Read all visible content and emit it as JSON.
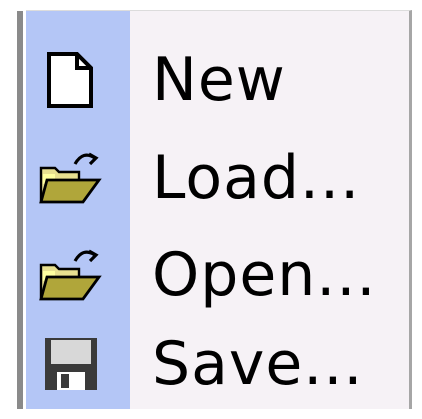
{
  "menu": {
    "items": [
      {
        "label": "New",
        "icon": "new-document-icon"
      },
      {
        "label": "Load...",
        "icon": "open-folder-icon"
      },
      {
        "label": "Open...",
        "icon": "open-folder-icon"
      },
      {
        "label": "Save...",
        "icon": "floppy-disk-icon"
      }
    ]
  },
  "colors": {
    "gutter": "#b4c6f6",
    "menu_bg": "#f6f2f6",
    "folder": "#b0a63a",
    "floppy": "#3a3a3a"
  }
}
